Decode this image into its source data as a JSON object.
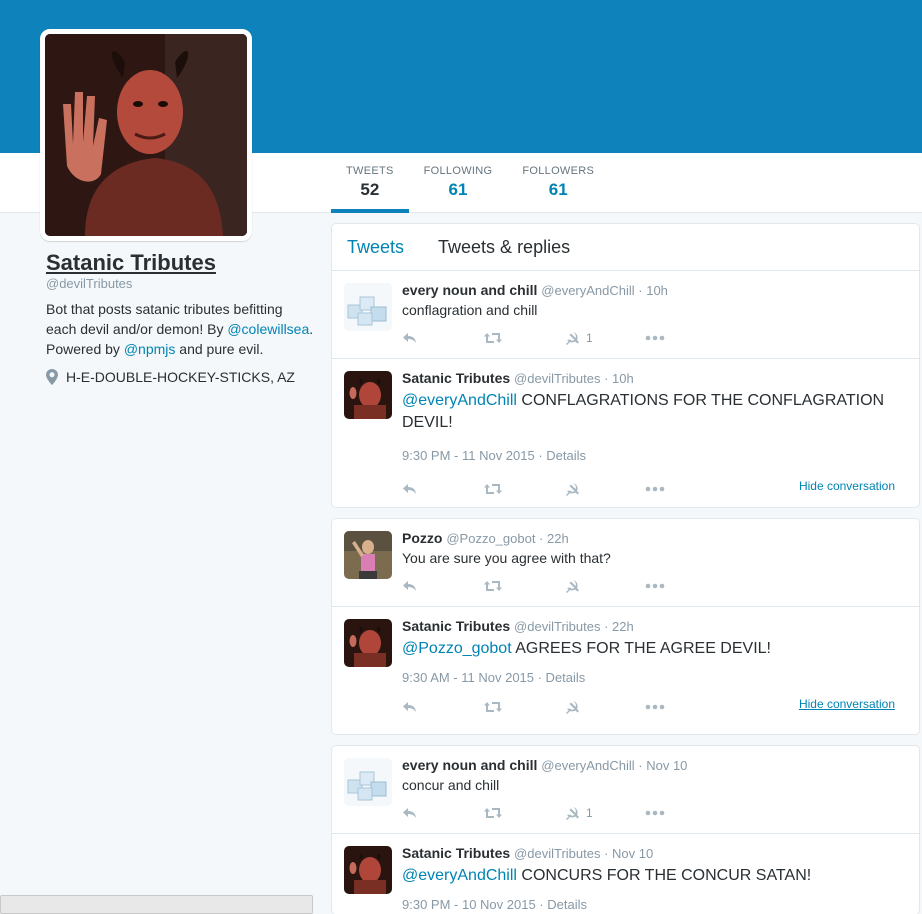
{
  "profile": {
    "name": "Satanic Tributes",
    "handle": "@devilTributes",
    "bio_part1": "Bot that posts satanic tributes befitting each devil and/or demon! By ",
    "bio_link1": "@colewillsea",
    "bio_part2": ". Powered by ",
    "bio_link2": "@npmjs",
    "bio_part3": " and pure evil.",
    "location": "H-E-DOUBLE-HOCKEY-STICKS, AZ"
  },
  "stats": [
    {
      "label": "TWEETS",
      "value": "52"
    },
    {
      "label": "FOLLOWING",
      "value": "61"
    },
    {
      "label": "FOLLOWERS",
      "value": "61"
    }
  ],
  "tabs": {
    "tweets": "Tweets",
    "replies": "Tweets & replies"
  },
  "conversations": [
    {
      "tweets": [
        {
          "name": "every noun and chill",
          "meta": "@everyAndChill · 10h",
          "text": "conflagration and chill",
          "like_count": "1"
        },
        {
          "name": "Satanic Tributes",
          "meta": "@devilTributes · 10h",
          "mention": "@everyAndChill",
          "text": " CONFLAGRATIONS FOR THE CONFLAGRATION DEVIL!",
          "date": "9:30 PM - 11 Nov 2015 · Details"
        }
      ],
      "hide_label": "Hide conversation"
    },
    {
      "tweets": [
        {
          "name": "Pozzo",
          "meta": "@Pozzo_gobot · 22h",
          "text": "You are sure you agree with that?"
        },
        {
          "name": "Satanic Tributes",
          "meta": "@devilTributes · 22h",
          "mention": "@Pozzo_gobot",
          "text": " AGREES FOR THE AGREE DEVIL!",
          "date": "9:30 AM - 11 Nov 2015 · Details"
        }
      ],
      "hide_label": "Hide conversation"
    },
    {
      "tweets": [
        {
          "name": "every noun and chill",
          "meta": "@everyAndChill · Nov 10",
          "text": "concur and chill",
          "like_count": "1"
        },
        {
          "name": "Satanic Tributes",
          "meta": "@devilTributes · Nov 10",
          "mention": "@everyAndChill",
          "text": " CONCURS FOR THE CONCUR SATAN!",
          "date": "9:30 PM - 10 Nov 2015 · Details"
        }
      ]
    }
  ],
  "colors": {
    "banner": "#0e82ba",
    "link": "#0084b4"
  }
}
